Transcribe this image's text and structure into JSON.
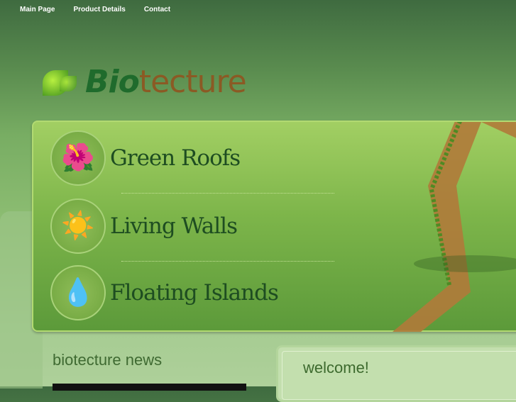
{
  "nav": [
    "Main Page",
    "Product Details",
    "Contact"
  ],
  "logo": {
    "part1": "Bio",
    "part2": "tecture"
  },
  "features": [
    {
      "label": "Green Roofs",
      "icon": "flower-icon"
    },
    {
      "label": "Living Walls",
      "icon": "sun-icon"
    },
    {
      "label": "Floating Islands",
      "icon": "water-drops-icon"
    }
  ],
  "news": {
    "title": "biotecture news"
  },
  "welcome": {
    "title": "welcome!"
  }
}
